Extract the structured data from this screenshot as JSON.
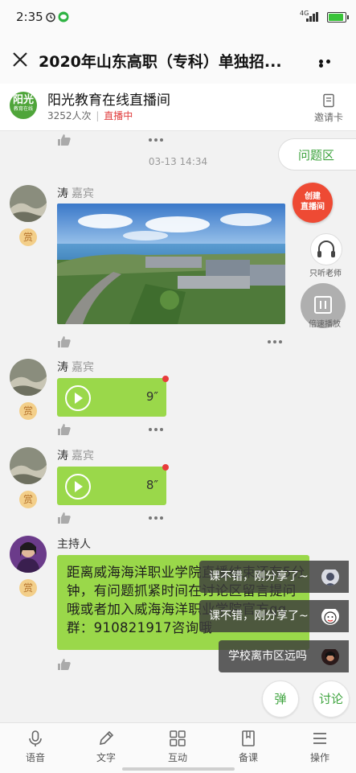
{
  "status": {
    "time": "2:35",
    "network": "4G",
    "battery_level": 1.0
  },
  "titlebar": {
    "title": "2020年山东高职（专科）单独招..."
  },
  "room": {
    "logo_text": "阳光",
    "logo_sub": "教育在线",
    "name": "阳光教育在线直播间",
    "viewers": "3252人次",
    "separator": "|",
    "live_status": "直播中",
    "invite_label": "邀请卡"
  },
  "chat": {
    "timestamp": "03-13 14:34",
    "guest_name": "涛",
    "guest_role": "嘉宾",
    "reward_label": "赏",
    "voice_messages": [
      {
        "duration": "9″"
      },
      {
        "duration": "8″"
      }
    ],
    "host_name": "主持人",
    "host_message": "距离威海海洋职业学院直播结束还有5分钟，有问题抓紧时间在讨论区留言提问哦或者加入威海海洋职业学院官方qq群：910821917咨询哦"
  },
  "side": {
    "qa_tab": "问题区",
    "create_line1": "创建",
    "create_line2": "直播间",
    "listen_teacher": "只听老师",
    "speed_play": "倍速播放"
  },
  "danmaku": [
    {
      "text": "课不错，刚分享了~"
    },
    {
      "text": "课不错，刚分享了~"
    },
    {
      "text": "学校离市区远吗"
    }
  ],
  "actions": {
    "danmaku_btn": "弹",
    "discuss_btn": "讨论"
  },
  "nav": [
    {
      "label": "语音",
      "icon": "mic-icon"
    },
    {
      "label": "文字",
      "icon": "pencil-icon"
    },
    {
      "label": "互动",
      "icon": "grid-icon"
    },
    {
      "label": "备课",
      "icon": "book-icon"
    },
    {
      "label": "操作",
      "icon": "menu-icon"
    }
  ],
  "colors": {
    "accent_green": "#3da33d",
    "bubble_green": "#9ad84a",
    "live_red": "#e03c3c",
    "create_red": "#ee4a34"
  }
}
